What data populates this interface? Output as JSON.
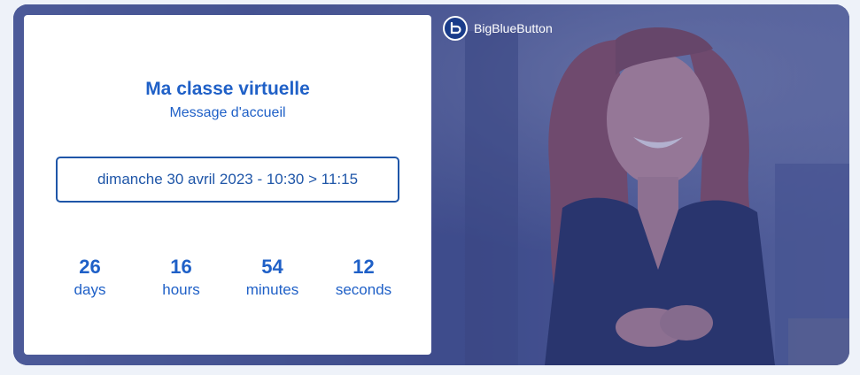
{
  "brand": {
    "name": "BigBlueButton",
    "logo_icon": "bigbluebutton-logo-icon"
  },
  "card": {
    "title": "Ma classe virtuelle",
    "subtitle": "Message d'accueil",
    "schedule": "dimanche 30 avril 2023 - 10:30 > 11:15"
  },
  "countdown": [
    {
      "value": "26",
      "label": "days"
    },
    {
      "value": "16",
      "label": "hours"
    },
    {
      "value": "54",
      "label": "minutes"
    },
    {
      "value": "12",
      "label": "seconds"
    }
  ],
  "colors": {
    "accent": "#1f60c7",
    "frame": "#4a5a93",
    "page_background": "#eef2f9"
  }
}
